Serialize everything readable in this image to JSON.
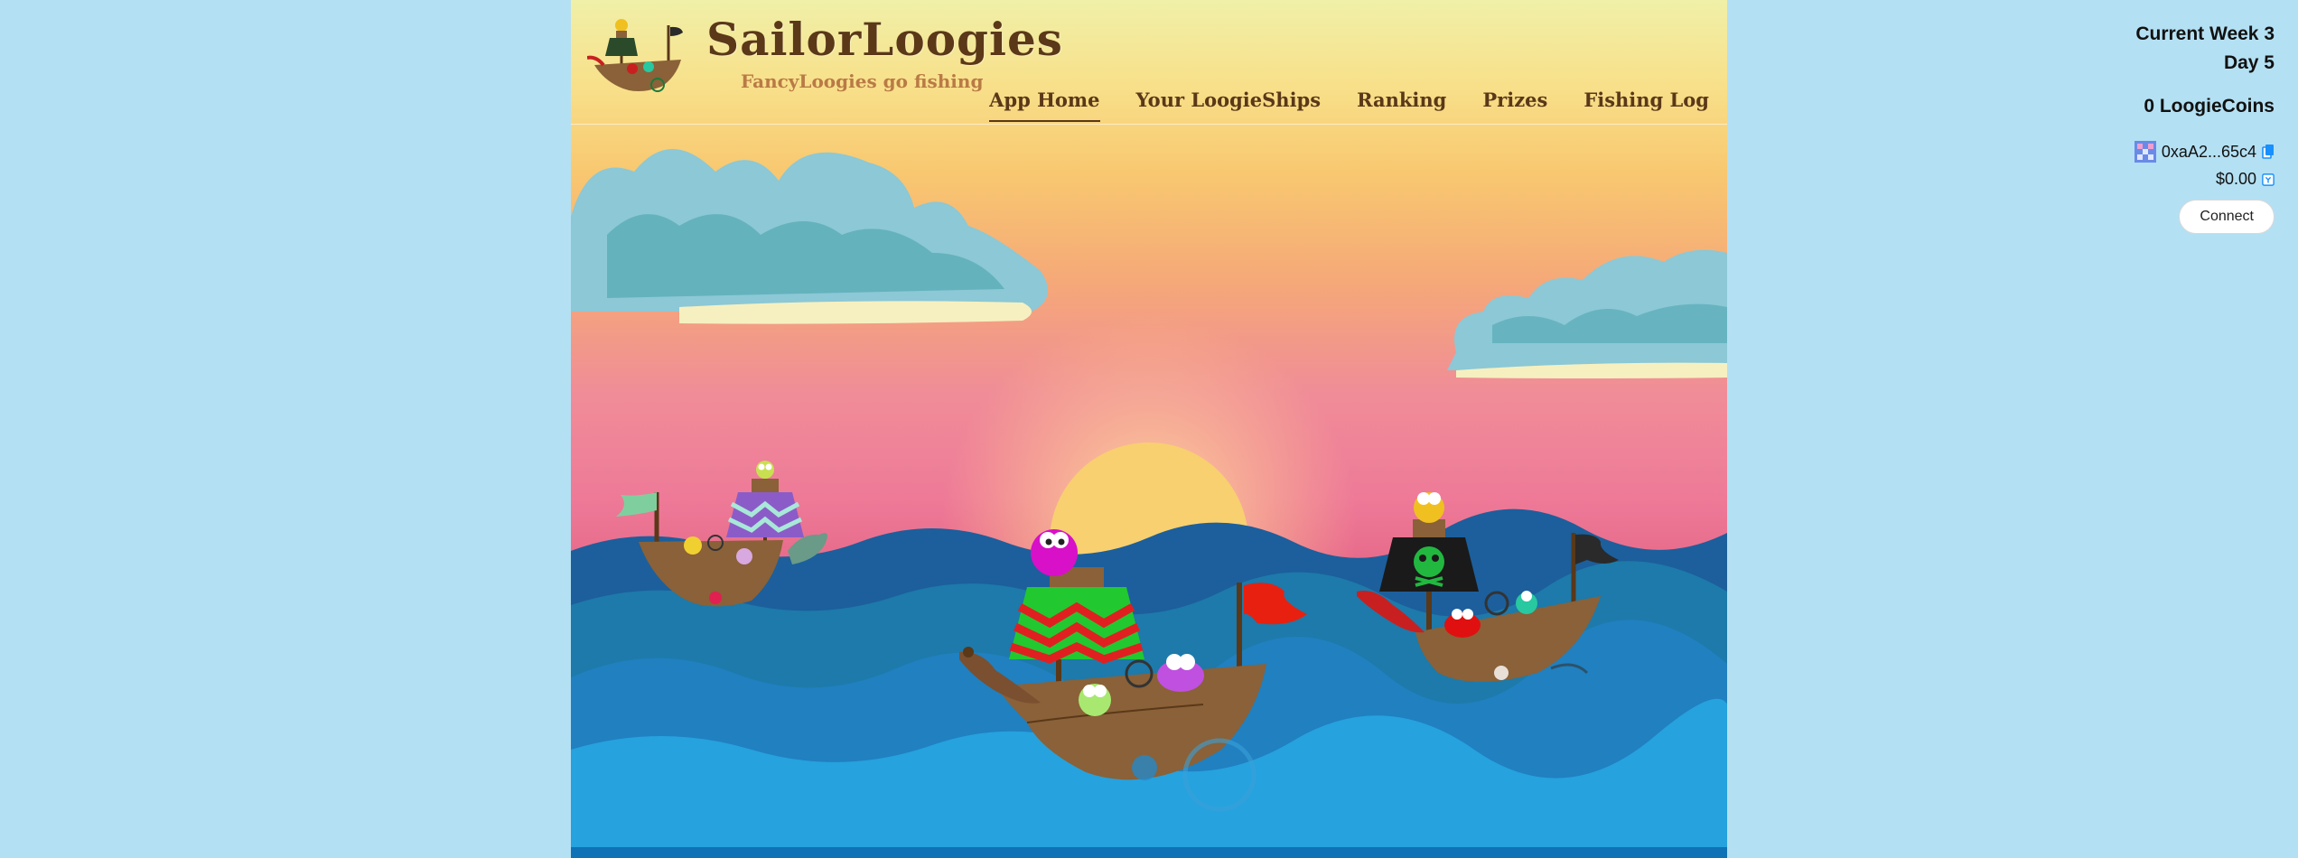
{
  "header": {
    "brand_title": "SailorLoogies",
    "brand_subtitle": "FancyLoogies go fishing"
  },
  "nav": {
    "items": [
      {
        "label": "App Home",
        "active": true
      },
      {
        "label": "Your LoogieShips",
        "active": false
      },
      {
        "label": "Ranking",
        "active": false
      },
      {
        "label": "Prizes",
        "active": false
      },
      {
        "label": "Fishing Log",
        "active": false
      }
    ]
  },
  "status": {
    "week_label": "Current Week 3",
    "day_label": "Day 5",
    "coins_label": "0 LoogieCoins"
  },
  "wallet": {
    "address": "0xaA2...65c4",
    "balance": "$0.00",
    "connect_label": "Connect"
  },
  "colors": {
    "page_background": "#b4e0f3",
    "brand_brown": "#5a3818",
    "sea_dark": "#1c5f9c",
    "sea_light": "#26a2de"
  },
  "icons": {
    "copy": "copy-icon",
    "avatar": "blockie-avatar-icon",
    "balance": "balance-icon"
  }
}
